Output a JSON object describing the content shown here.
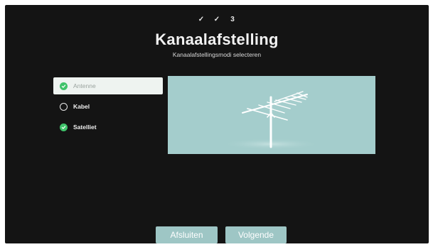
{
  "steps": [
    {
      "label": "✓",
      "state": "done"
    },
    {
      "label": "✓",
      "state": "done"
    },
    {
      "label": "3",
      "state": "current"
    }
  ],
  "header": {
    "title": "Kanaalafstelling",
    "subtitle": "Kanaalafstellingsmodi selecteren"
  },
  "options": [
    {
      "label": "Antenne",
      "selected": true,
      "checked": true
    },
    {
      "label": "Kabel",
      "selected": false,
      "checked": false
    },
    {
      "label": "Satelliet",
      "selected": false,
      "checked": true
    }
  ],
  "illustration": {
    "icon": "antenna-icon",
    "background": "#a4cdcc"
  },
  "buttons": {
    "finish_label": "Afsluiten",
    "next_label": "Volgende"
  },
  "colors": {
    "accent_check": "#3fc36a",
    "button_bg": "#9ec6c5",
    "screen_bg": "#141414"
  }
}
